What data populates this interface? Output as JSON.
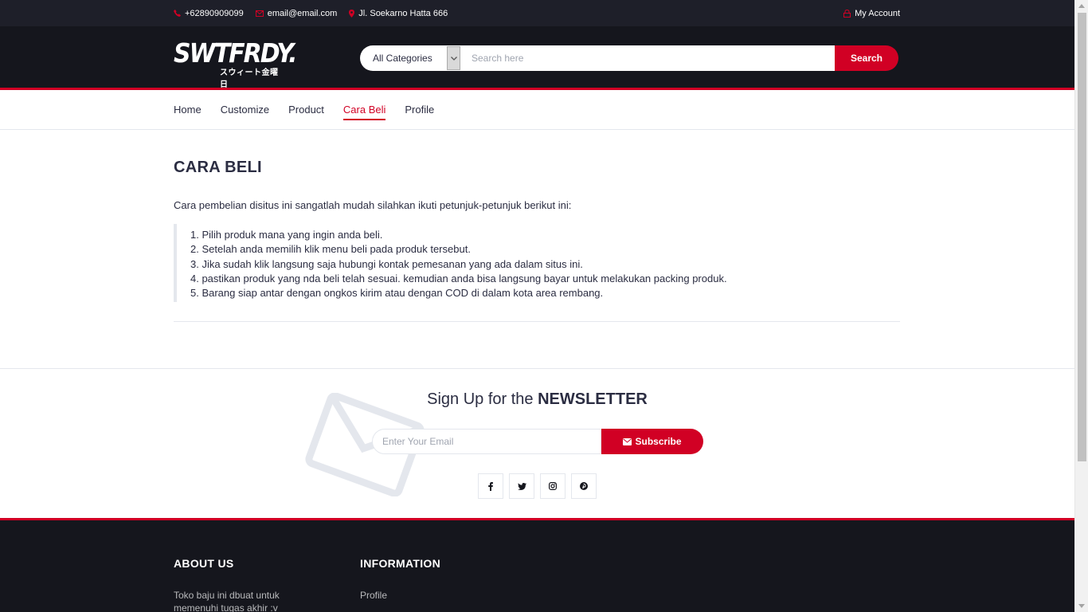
{
  "topbar": {
    "phone": "+62890909099",
    "email": "email@email.com",
    "address": "Jl. Soekarno Hatta 666",
    "account": "My Account"
  },
  "header": {
    "logo_text": "SWTFRDY.",
    "logo_subtext": "スウィート金曜日",
    "category_selected": "All Categories",
    "search_placeholder": "Search here",
    "search_button": "Search"
  },
  "nav": {
    "items": [
      "Home",
      "Customize",
      "Product",
      "Cara Beli",
      "Profile"
    ],
    "active": "Cara Beli"
  },
  "main": {
    "title": "CARA BELI",
    "intro": "Cara pembelian disitus ini sangatlah mudah silahkan ikuti petunjuk-petunjuk berikut ini:",
    "steps": [
      "1. Pilih produk mana yang ingin anda beli.",
      "2. Setelah anda memilih klik menu beli pada produk tersebut.",
      "3. Jika sudah klik langsung saja hubungi kontak pemesanan yang ada dalam situs ini.",
      "4. pastikan produk yang nda beli telah sesuai. kemudian anda bisa langsung bayar untuk melakukan packing produk.",
      "5. Barang siap antar dengan ongkos kirim atau dengan COD di dalam kota area rembang."
    ]
  },
  "newsletter": {
    "title_prefix": "Sign Up for the ",
    "title_strong": "NEWSLETTER",
    "email_placeholder": "Enter Your Email",
    "subscribe_button": "Subscribe",
    "social_icons": [
      "facebook-icon",
      "twitter-icon",
      "instagram-icon",
      "pinterest-icon"
    ]
  },
  "footer": {
    "about_title": "ABOUT US",
    "about_text": "Toko baju ini dbuat untuk memenuhi tugas akhir :v",
    "info_title": "INFORMATION",
    "info_links": [
      "Profile"
    ]
  },
  "colors": {
    "accent": "#d10024",
    "dark": "#15161d",
    "topbar": "#1e1f29",
    "text": "#2b2d42"
  }
}
